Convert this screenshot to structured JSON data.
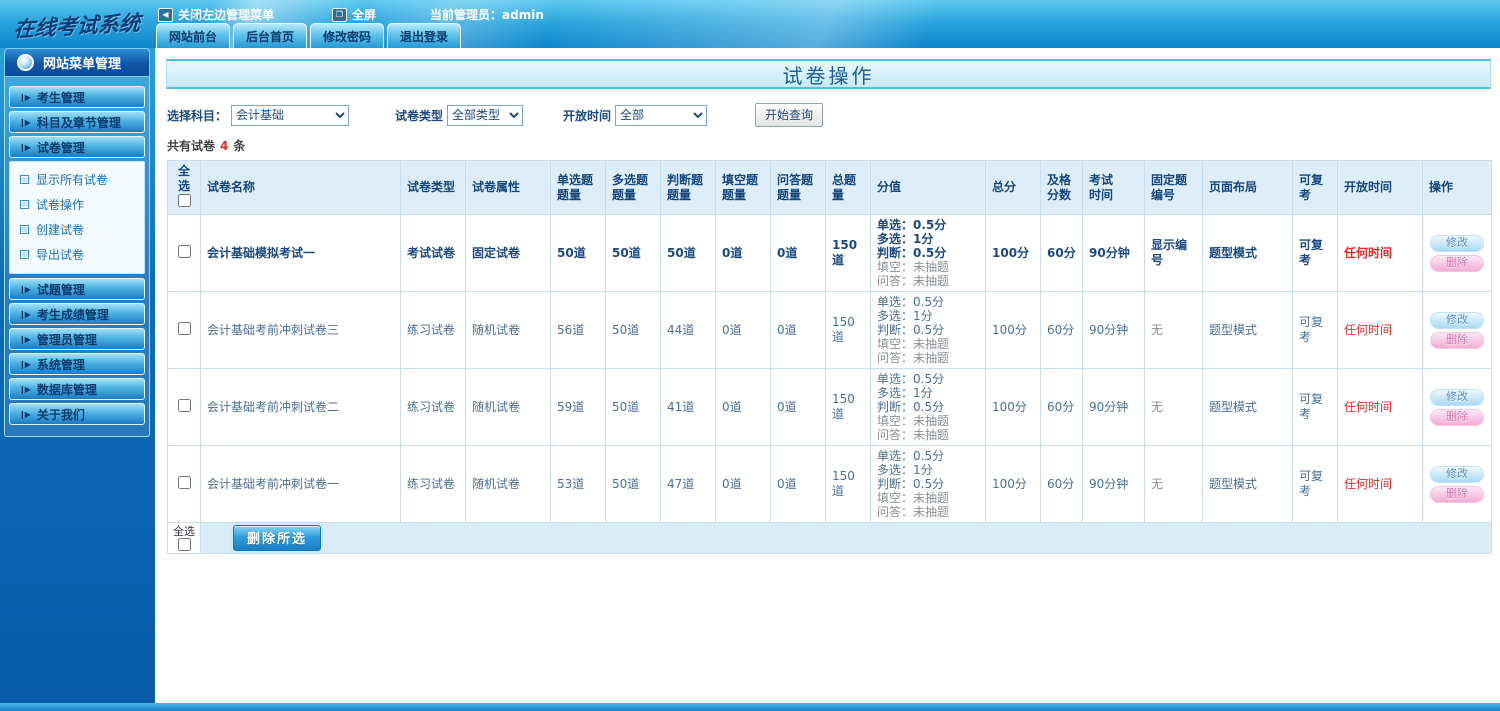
{
  "topbar": {
    "logo": "在线考试系统",
    "close_menu_label": "关闭左边管理菜单",
    "fullscreen_label": "全屏",
    "admin_label": "当前管理员：",
    "admin_name": "admin",
    "tabs": [
      {
        "label": "网站前台"
      },
      {
        "label": "后台首页"
      },
      {
        "label": "修改密码"
      },
      {
        "label": "退出登录"
      }
    ]
  },
  "sidebar": {
    "header": "网站菜单管理",
    "groups": [
      {
        "label": "考生管理"
      },
      {
        "label": "科目及章节管理"
      },
      {
        "label": "试卷管理",
        "children": [
          "显示所有试卷",
          "试卷操作",
          "创建试卷",
          "导出试卷"
        ]
      },
      {
        "label": "试题管理"
      },
      {
        "label": "考生成绩管理"
      },
      {
        "label": "管理员管理"
      },
      {
        "label": "系统管理"
      },
      {
        "label": "数据库管理"
      },
      {
        "label": "关于我们"
      }
    ]
  },
  "main": {
    "title": "试卷操作",
    "filters": {
      "subject_label": "选择科目：",
      "subject_value": "会计基础",
      "type_label": "试卷类型",
      "type_value": "全部类型",
      "open_label": "开放时间",
      "open_value": "全部",
      "query_button": "开始查询"
    },
    "count": {
      "prefix": "共有试卷",
      "number": "4",
      "suffix": "条"
    },
    "table": {
      "headers": [
        "全选",
        "试卷名称",
        "试卷类型",
        "试卷属性",
        "单选题\n题量",
        "多选题\n题量",
        "判断题\n题量",
        "填空题\n题量",
        "问答题\n题量",
        "总题量",
        "分值",
        "总分",
        "及格\n分数",
        "考试\n时间",
        "固定题\n编号",
        "页面布局",
        "可复考",
        "开放时间",
        "操作"
      ],
      "actions": {
        "edit": "修改",
        "delete": "删除"
      },
      "rows": [
        {
          "name": "会计基础模拟考试一",
          "type": "考试试卷",
          "attr": "固定试卷",
          "single": "50道",
          "multi": "50道",
          "judge": "50道",
          "blank": "0道",
          "qa": "0道",
          "total_q": "150道",
          "score_lines": [
            "单选：0.5分",
            "多选：1分",
            "判断：0.5分",
            "填空：未抽题",
            "问答：未抽题"
          ],
          "total": "100分",
          "pass": "60分",
          "time": "90分钟",
          "fixed": "显示编号",
          "layout": "题型模式",
          "retake": "可复考",
          "open": "任何时间",
          "emphasis": true
        },
        {
          "name": "会计基础考前冲刺试卷三",
          "type": "练习试卷",
          "attr": "随机试卷",
          "single": "56道",
          "multi": "50道",
          "judge": "44道",
          "blank": "0道",
          "qa": "0道",
          "total_q": "150道",
          "score_lines": [
            "单选：0.5分",
            "多选：1分",
            "判断：0.5分",
            "填空：未抽题",
            "问答：未抽题"
          ],
          "total": "100分",
          "pass": "60分",
          "time": "90分钟",
          "fixed": "无",
          "layout": "题型模式",
          "retake": "可复考",
          "open": "任何时间",
          "emphasis": false
        },
        {
          "name": "会计基础考前冲刺试卷二",
          "type": "练习试卷",
          "attr": "随机试卷",
          "single": "59道",
          "multi": "50道",
          "judge": "41道",
          "blank": "0道",
          "qa": "0道",
          "total_q": "150道",
          "score_lines": [
            "单选：0.5分",
            "多选：1分",
            "判断：0.5分",
            "填空：未抽题",
            "问答：未抽题"
          ],
          "total": "100分",
          "pass": "60分",
          "time": "90分钟",
          "fixed": "无",
          "layout": "题型模式",
          "retake": "可复考",
          "open": "任何时间",
          "emphasis": false
        },
        {
          "name": "会计基础考前冲刺试卷一",
          "type": "练习试卷",
          "attr": "随机试卷",
          "single": "53道",
          "multi": "50道",
          "judge": "47道",
          "blank": "0道",
          "qa": "0道",
          "total_q": "150道",
          "score_lines": [
            "单选：0.5分",
            "多选：1分",
            "判断：0.5分",
            "填空：未抽题",
            "问答：未抽题"
          ],
          "total": "100分",
          "pass": "60分",
          "time": "90分钟",
          "fixed": "无",
          "layout": "题型模式",
          "retake": "可复考",
          "open": "任何时间",
          "emphasis": false
        }
      ],
      "footer": {
        "select_all": "全选",
        "delete_button": "删除所选"
      }
    }
  },
  "icons": {
    "close_menu": "close-panel-arrow-icon",
    "fullscreen": "fullscreen-icon",
    "sidebar_orb": "orb-icon",
    "group_arrow": "play-icon",
    "subitem_bullet": "list-square-icon"
  },
  "colors": {
    "topbar_blue": "#1794d6",
    "sidebar_blue": "#0d6cba",
    "banner_blue": "#c6eafa",
    "header_cell_blue": "#ddeefa",
    "navy_text": "#1c4a80",
    "red_text": "#e02b2b",
    "edit_pill": "#a9d9f1",
    "delete_pill": "#f2abd5"
  }
}
